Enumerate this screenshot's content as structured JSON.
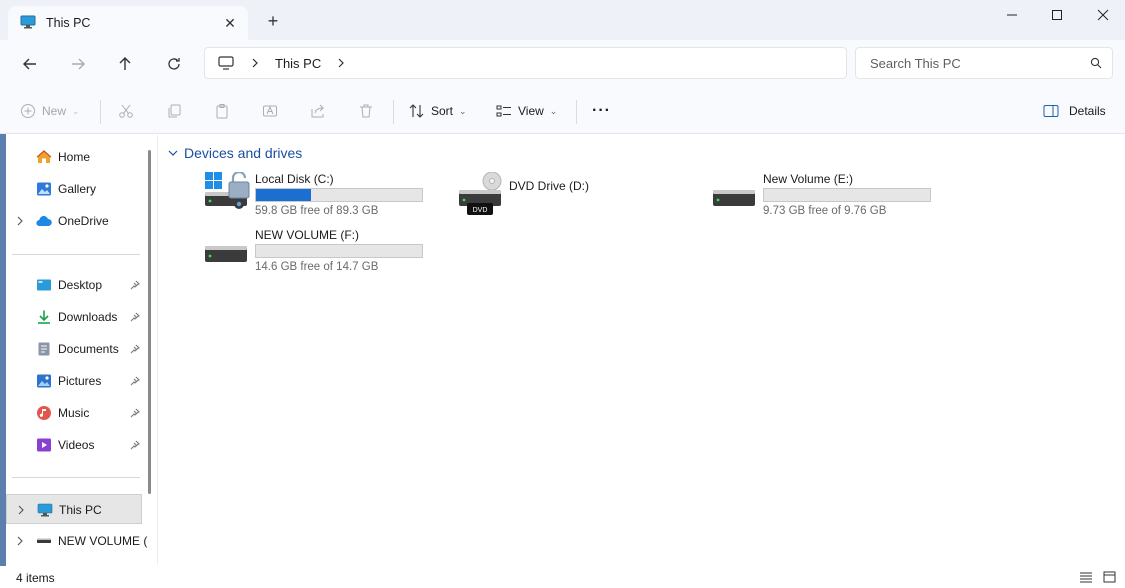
{
  "window": {
    "tab_title": "This PC",
    "close_tab_glyph": "✕",
    "new_tab_glyph": "+"
  },
  "address": {
    "segments": [
      "This PC"
    ]
  },
  "search": {
    "placeholder": "Search This PC"
  },
  "toolbar": {
    "new_label": "New",
    "sort_label": "Sort",
    "view_label": "View",
    "more_label": "···",
    "details_label": "Details"
  },
  "sidebar": {
    "quick": [
      {
        "label": "Home",
        "icon": "home-icon"
      },
      {
        "label": "Gallery",
        "icon": "gallery-icon"
      },
      {
        "label": "OneDrive",
        "icon": "onedrive-icon"
      }
    ],
    "pinned": [
      {
        "label": "Desktop",
        "icon": "desktop-icon"
      },
      {
        "label": "Downloads",
        "icon": "downloads-icon"
      },
      {
        "label": "Documents",
        "icon": "documents-icon"
      },
      {
        "label": "Pictures",
        "icon": "pictures-icon"
      },
      {
        "label": "Music",
        "icon": "music-icon"
      },
      {
        "label": "Videos",
        "icon": "videos-icon"
      }
    ],
    "devices": [
      {
        "label": "This PC",
        "icon": "this-pc-icon"
      },
      {
        "label": "NEW VOLUME (",
        "icon": "drive-icon"
      }
    ]
  },
  "content": {
    "group_title": "Devices and drives",
    "drives": [
      {
        "name": "Local Disk (C:)",
        "free": "59.8 GB free of 89.3 GB",
        "used_fraction": 0.33
      },
      {
        "name": "DVD Drive (D:)",
        "free": "",
        "badge": "DVD"
      },
      {
        "name": "New Volume (E:)",
        "free": "9.73 GB free of 9.76 GB",
        "used_fraction": 0.0
      },
      {
        "name": "NEW VOLUME (F:)",
        "free": "14.6 GB free of 14.7 GB",
        "used_fraction": 0.0
      }
    ]
  },
  "status": {
    "item_count": "4 items"
  },
  "colors": {
    "accent": "#1a6fd1",
    "group_title": "#1a4fa0"
  }
}
